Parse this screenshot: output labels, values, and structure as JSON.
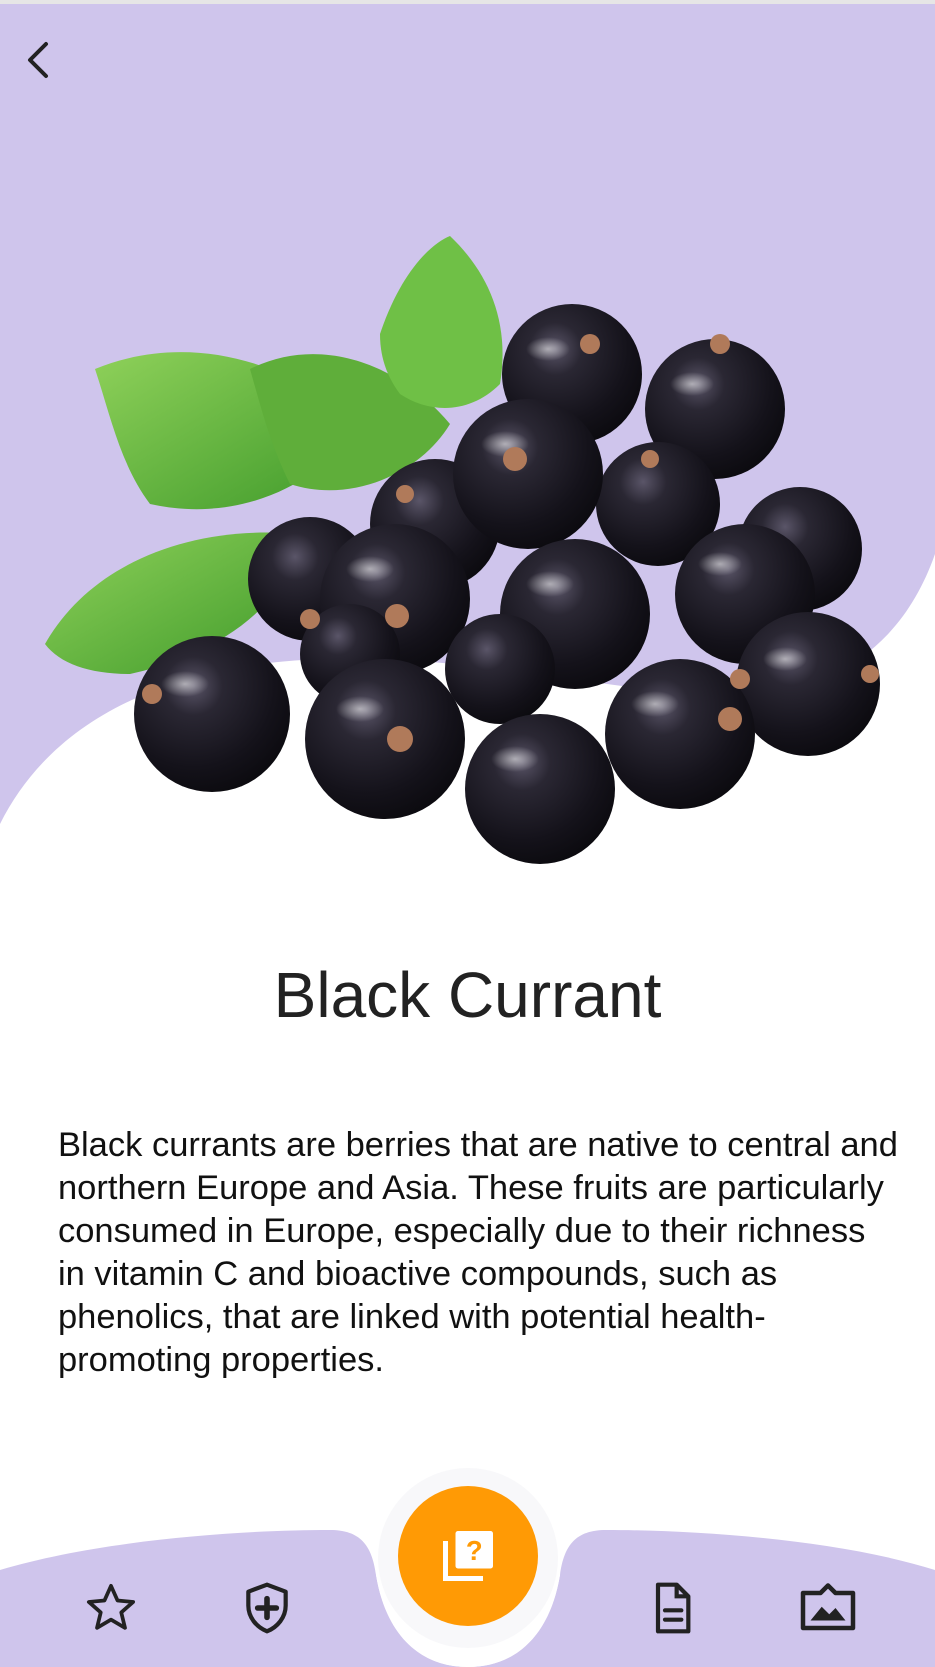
{
  "colors": {
    "accent_lavender": "#cfc5ec",
    "fab_orange": "#ff9a05",
    "icon_dark": "#222222"
  },
  "header": {
    "back_icon": "chevron-left-icon"
  },
  "hero": {
    "image_subject": "black currant berries with leaves"
  },
  "fruit": {
    "name": "Black Currant",
    "description": "Black currants are berries that are native to central and northern Europe and Asia. These fruits are particularly consumed in Europe, especially due to their richness in vitamin C and bioactive compounds, such as phenolics, that are linked with potential health-promoting properties."
  },
  "bottom_nav": {
    "items": [
      {
        "icon": "star-icon"
      },
      {
        "icon": "shield-plus-icon"
      },
      {
        "icon": "quiz-icon",
        "center": true
      },
      {
        "icon": "document-icon"
      },
      {
        "icon": "image-icon"
      }
    ]
  }
}
